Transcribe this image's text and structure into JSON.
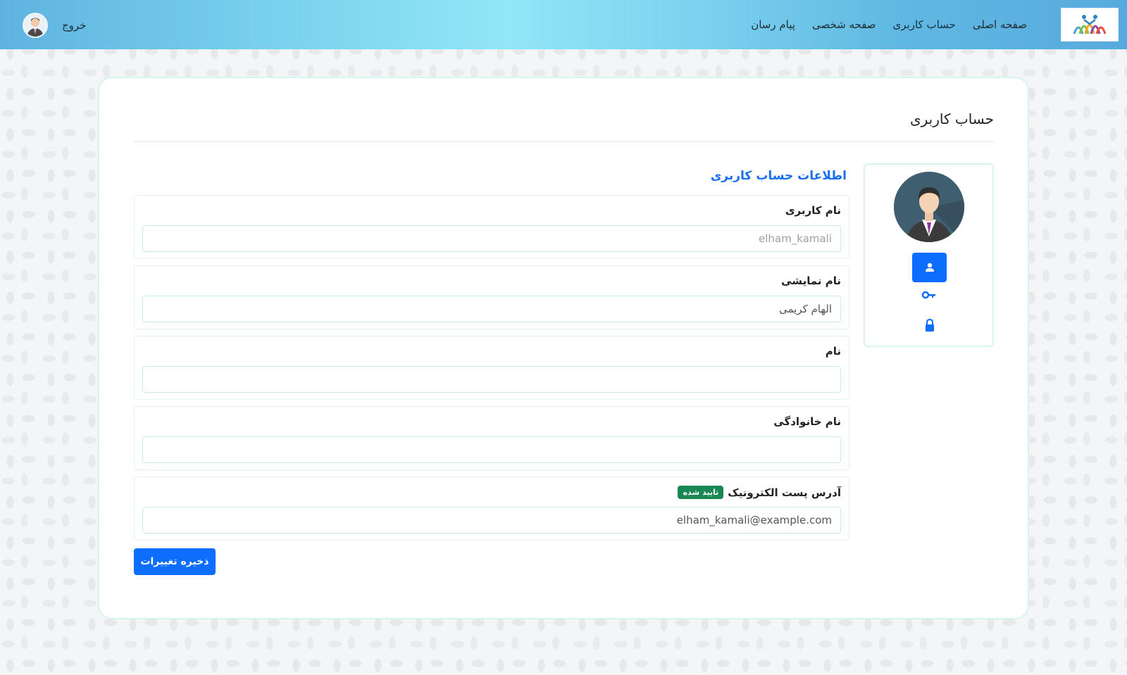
{
  "navbar": {
    "links": [
      {
        "label": "صفحه اصلی"
      },
      {
        "label": "حساب کاربری"
      },
      {
        "label": "صفحه شخصی"
      },
      {
        "label": "پیام رسان"
      }
    ],
    "logout_label": "خروج",
    "logo_icon": "books-people-logo-icon",
    "avatar_icon": "user-avatar-icon"
  },
  "page": {
    "title": "حساب کاربری"
  },
  "side_panel": {
    "avatar_icon": "businessman-avatar-icon",
    "buttons": [
      {
        "icon": "user-icon",
        "active": true
      },
      {
        "icon": "key-icon",
        "active": false
      },
      {
        "icon": "lock-icon",
        "active": false
      }
    ]
  },
  "form": {
    "section_title": "اطلاعات حساب کاربری",
    "fields": {
      "username": {
        "label": "نام کاربری",
        "placeholder": "elham_kamali",
        "value": ""
      },
      "display_name": {
        "label": "نام نمایشی",
        "placeholder": "",
        "value": "الهام کریمی"
      },
      "first_name": {
        "label": "نام",
        "placeholder": "",
        "value": ""
      },
      "last_name": {
        "label": "نام خانوادگی",
        "placeholder": "",
        "value": ""
      },
      "email": {
        "label": "آدرس پست الکترونیک",
        "badge": "تایید شده",
        "placeholder": "",
        "value": "elham_kamali@example.com"
      }
    },
    "save_label": "ذخیره تغییرات"
  },
  "colors": {
    "primary": "#0d6efd",
    "success": "#198754",
    "accent_border": "#d6f5ec"
  }
}
